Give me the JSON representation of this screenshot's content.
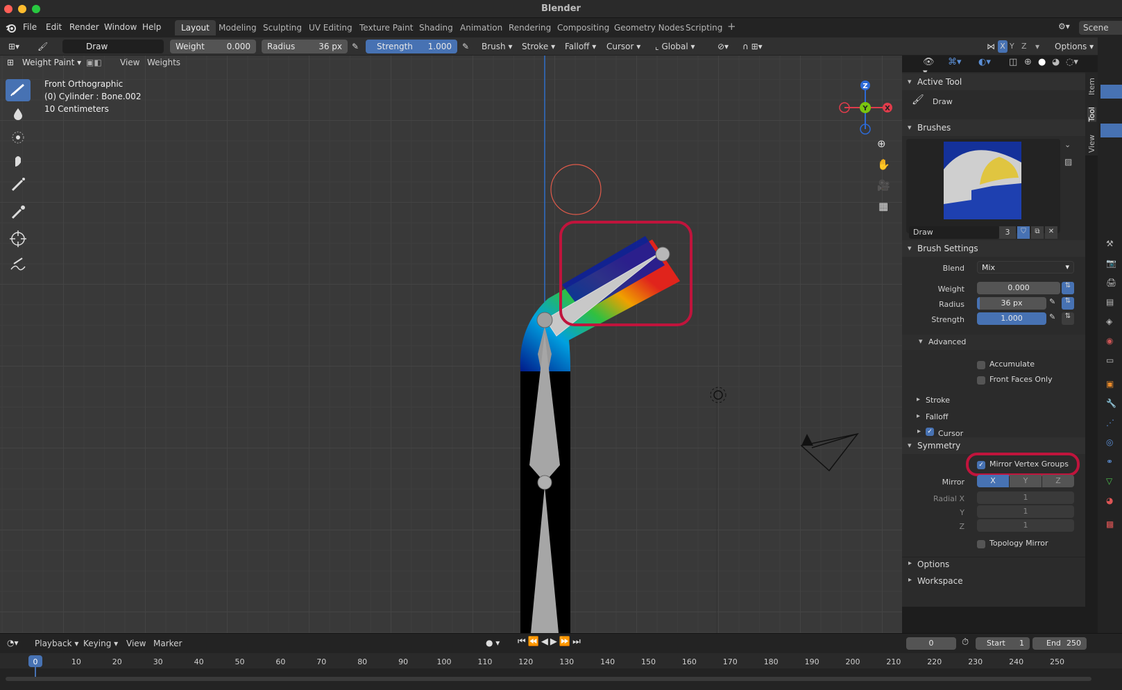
{
  "window": {
    "title": "Blender"
  },
  "menu": [
    "File",
    "Edit",
    "Render",
    "Window",
    "Help"
  ],
  "workspaces": [
    "Layout",
    "Modeling",
    "Sculpting",
    "UV Editing",
    "Texture Paint",
    "Shading",
    "Animation",
    "Rendering",
    "Compositing",
    "Geometry Nodes",
    "Scripting"
  ],
  "scene": "Scene",
  "toolbar": {
    "brush_name": "Draw",
    "weight_label": "Weight",
    "weight": "0.000",
    "radius_label": "Radius",
    "radius": "36 px",
    "strength_label": "Strength",
    "strength": "1.000",
    "brush": "Brush",
    "stroke": "Stroke",
    "falloff": "Falloff",
    "cursor": "Cursor",
    "orientation": "Global",
    "options": "Options",
    "axes": [
      "X",
      "Y",
      "Z"
    ]
  },
  "viewport": {
    "mode": "Weight Paint",
    "menus": [
      "View",
      "Weights"
    ],
    "overlay": [
      "Front Orthographic",
      "(0) Cylinder : Bone.002",
      "10 Centimeters"
    ],
    "gizmo": {
      "z": "Z",
      "y": "Y",
      "x": "X"
    }
  },
  "npanel": {
    "tabs": [
      "Item",
      "Tool",
      "View"
    ],
    "active_tool": {
      "title": "Active Tool",
      "tool": "Draw"
    },
    "brushes": {
      "title": "Brushes",
      "name": "Draw",
      "users": "3"
    },
    "brush_settings": {
      "title": "Brush Settings",
      "blend_label": "Blend",
      "blend": "Mix",
      "weight_label": "Weight",
      "weight": "0.000",
      "radius_label": "Radius",
      "radius": "36 px",
      "strength_label": "Strength",
      "strength": "1.000"
    },
    "advanced": {
      "title": "Advanced",
      "accumulate": "Accumulate",
      "front_faces": "Front Faces Only"
    },
    "stroke": "Stroke",
    "falloff": "Falloff",
    "cursor": "Cursor",
    "symmetry": {
      "title": "Symmetry",
      "mirror_vg": "Mirror Vertex Groups",
      "mirror_label": "Mirror",
      "axes": [
        "X",
        "Y",
        "Z"
      ],
      "radial_x_label": "Radial X",
      "radial_x": "1",
      "y_label": "Y",
      "y": "1",
      "z_label": "Z",
      "z": "1",
      "topology": "Topology Mirror"
    },
    "options": "Options",
    "workspace": "Workspace"
  },
  "timeline": {
    "menus": [
      "Playback",
      "Keying",
      "View",
      "Marker"
    ],
    "current": "0",
    "start_label": "Start",
    "start": "1",
    "end_label": "End",
    "end": "250",
    "ticks": [
      "0",
      "10",
      "20",
      "30",
      "40",
      "50",
      "60",
      "70",
      "80",
      "90",
      "100",
      "110",
      "120",
      "130",
      "140",
      "150",
      "160",
      "170",
      "180",
      "190",
      "200",
      "210",
      "220",
      "230",
      "240",
      "250"
    ]
  },
  "colors": {
    "accent": "#4772b3",
    "highlight": "#c0143c"
  }
}
